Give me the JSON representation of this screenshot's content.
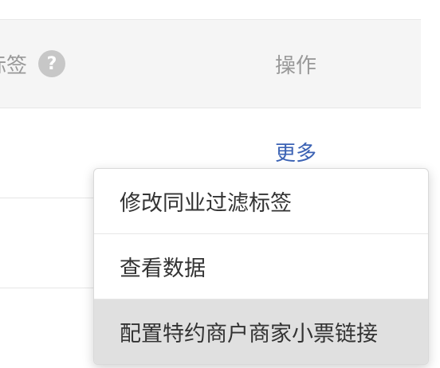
{
  "table": {
    "header": {
      "tags_label": "标签",
      "help_icon": "question-icon",
      "ops_label": "操作"
    },
    "rows": [
      {
        "action_label": "更多"
      },
      {},
      {}
    ]
  },
  "dropdown": {
    "items": [
      {
        "label": "修改同业过滤标签",
        "highlighted": false
      },
      {
        "label": "查看数据",
        "highlighted": false
      },
      {
        "label": "配置特约商户商家小票链接",
        "highlighted": true
      }
    ]
  },
  "colors": {
    "link": "#3b62b4",
    "header_bg": "#f5f5f5",
    "highlight_bg": "#e0e0e0"
  }
}
